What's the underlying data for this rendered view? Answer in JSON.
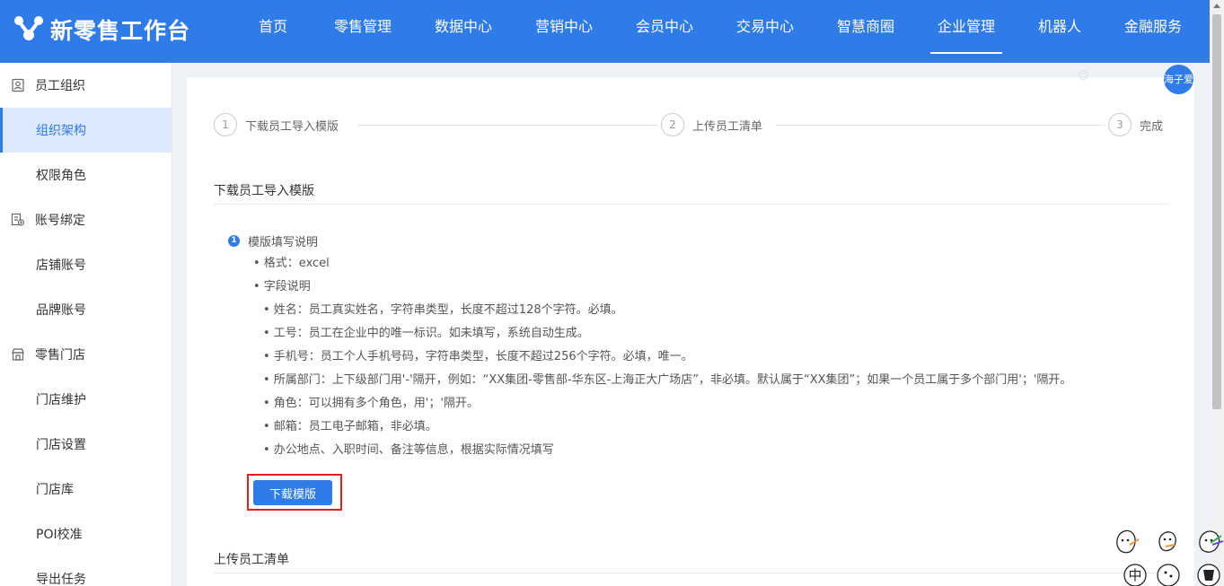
{
  "app": {
    "logo_text": "新零售工作台",
    "logo_icon": "brand-logo-icon"
  },
  "nav": {
    "items": [
      {
        "label": "首页"
      },
      {
        "label": "零售管理"
      },
      {
        "label": "数据中心"
      },
      {
        "label": "营销中心"
      },
      {
        "label": "会员中心"
      },
      {
        "label": "交易中心"
      },
      {
        "label": "智慧商圈"
      },
      {
        "label": "企业管理",
        "active": true
      },
      {
        "label": "机器人"
      },
      {
        "label": "金融服务"
      }
    ]
  },
  "sidebar": {
    "items": [
      {
        "label": "员工组织",
        "type": "group",
        "icon": "person-card-icon"
      },
      {
        "label": "组织架构",
        "type": "sub",
        "active": true
      },
      {
        "label": "权限角色",
        "type": "sub"
      },
      {
        "label": "账号绑定",
        "type": "group",
        "icon": "account-link-icon"
      },
      {
        "label": "店铺账号",
        "type": "sub"
      },
      {
        "label": "品牌账号",
        "type": "sub"
      },
      {
        "label": "零售门店",
        "type": "group",
        "icon": "store-icon"
      },
      {
        "label": "门店维护",
        "type": "sub"
      },
      {
        "label": "门店设置",
        "type": "sub"
      },
      {
        "label": "门店库",
        "type": "sub"
      },
      {
        "label": "POI校准",
        "type": "sub"
      },
      {
        "label": "导出任务",
        "type": "sub"
      }
    ]
  },
  "user": {
    "avatar_text": "海子爱"
  },
  "steps": [
    {
      "num": "1",
      "label": "下载员工导入模版"
    },
    {
      "num": "2",
      "label": "上传员工清单"
    },
    {
      "num": "3",
      "label": "完成"
    }
  ],
  "section1": {
    "title": "下载员工导入模版",
    "notes_title": "模版填写说明",
    "info_num": "1",
    "lines": [
      "• 格式：excel",
      "• 字段说明",
      "• 姓名：员工真实姓名，字符串类型，长度不超过128个字符。必填。",
      "• 工号：员工在企业中的唯一标识。如未填写，系统自动生成。",
      "• 手机号：员工个人手机号码，字符串类型，长度不超过256个字符。必填，唯一。",
      "• 所属部门：上下级部门用'-'隔开，例如：“XX集团-零售部-华东区-上海正大广场店”，非必填。默认属于“XX集团”；如果一个员工属于多个部门用'；'隔开。",
      "• 角色：可以拥有多个角色，用'；'隔开。",
      "• 邮箱：员工电子邮箱，非必填。",
      "• 办公地点、入职时间、备注等信息，根据实际情况填写"
    ],
    "download_button": "下载模版"
  },
  "section2": {
    "title": "上传员工清单"
  },
  "stickers": {
    "badge_text": "中"
  },
  "colors": {
    "primary": "#2f7be8",
    "highlight": "#e02020",
    "sidebar_active_bg": "#dce8fb"
  }
}
